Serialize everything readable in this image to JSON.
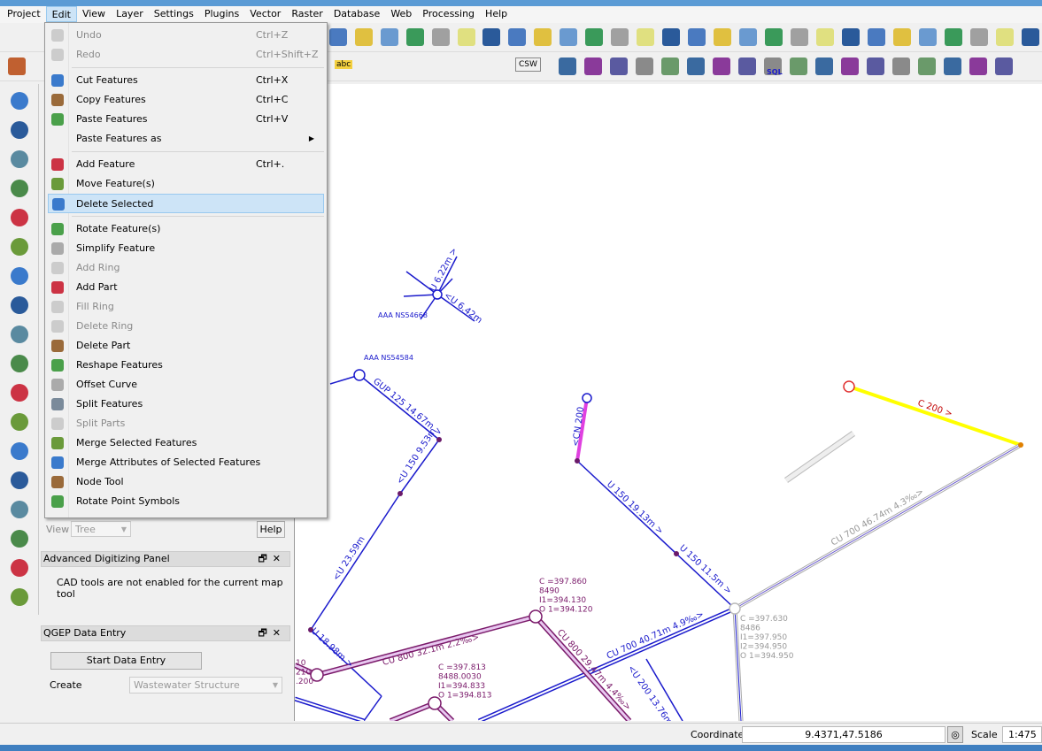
{
  "menubar": [
    "Project",
    "Edit",
    "View",
    "Layer",
    "Settings",
    "Plugins",
    "Vector",
    "Raster",
    "Database",
    "Web",
    "Processing",
    "Help"
  ],
  "edit_menu": [
    {
      "label": "Undo",
      "shortcut": "Ctrl+Z",
      "disabled": true,
      "icon": "undo-icon"
    },
    {
      "label": "Redo",
      "shortcut": "Ctrl+Shift+Z",
      "disabled": true,
      "icon": "redo-icon"
    },
    {
      "sep": true
    },
    {
      "label": "Cut Features",
      "shortcut": "Ctrl+X",
      "icon": "scissors-icon"
    },
    {
      "label": "Copy Features",
      "shortcut": "Ctrl+C",
      "icon": "copy-icon"
    },
    {
      "label": "Paste Features",
      "shortcut": "Ctrl+V",
      "icon": "paste-icon"
    },
    {
      "label": "Paste Features as",
      "submenu": true
    },
    {
      "sep": true
    },
    {
      "label": "Add Feature",
      "shortcut": "Ctrl+.",
      "icon": "add-feature-icon"
    },
    {
      "label": "Move Feature(s)",
      "icon": "move-feature-icon"
    },
    {
      "label": "Delete Selected",
      "icon": "trash-icon",
      "highlighted": true
    },
    {
      "sep": true
    },
    {
      "label": "Rotate Feature(s)",
      "icon": "rotate-feature-icon"
    },
    {
      "label": "Simplify Feature",
      "icon": "simplify-icon"
    },
    {
      "label": "Add Ring",
      "disabled": true,
      "icon": "add-ring-icon"
    },
    {
      "label": "Add Part",
      "icon": "add-part-icon"
    },
    {
      "label": "Fill Ring",
      "disabled": true,
      "icon": "fill-ring-icon"
    },
    {
      "label": "Delete Ring",
      "disabled": true,
      "icon": "delete-ring-icon"
    },
    {
      "label": "Delete Part",
      "icon": "delete-part-icon"
    },
    {
      "label": "Reshape Features",
      "icon": "reshape-icon"
    },
    {
      "label": "Offset Curve",
      "icon": "offset-curve-icon"
    },
    {
      "label": "Split Features",
      "icon": "split-features-icon"
    },
    {
      "label": "Split Parts",
      "disabled": true,
      "icon": "split-parts-icon"
    },
    {
      "label": "Merge Selected Features",
      "icon": "merge-features-icon"
    },
    {
      "label": "Merge Attributes of Selected Features",
      "icon": "merge-attributes-icon"
    },
    {
      "label": "Node Tool",
      "icon": "node-tool-icon"
    },
    {
      "label": "Rotate Point Symbols",
      "icon": "rotate-symbols-icon"
    }
  ],
  "toolbar": {
    "csw_label": "CSW",
    "sql_label": "SQL",
    "abc_label": "abc"
  },
  "layers_panel": {
    "view_label": "View",
    "view_value": "Tree",
    "help_label": "Help"
  },
  "advanced_digitizing": {
    "title": "Advanced Digitizing Panel",
    "message": "CAD tools are not enabled for the current map tool"
  },
  "qgep": {
    "title": "QGEP Data Entry",
    "start_button": "Start Data Entry",
    "create_label": "Create",
    "create_value": "Wastewater Structure"
  },
  "map_labels": {
    "l1": "AAA NS54668",
    "l2": "U 6.22m >",
    "l3": "<U 6.42m",
    "l4": "AAA NS54584",
    "l5": "GUP 125 14.67m >",
    "l6": "<U 150 9.53m",
    "l7": "<U 23.59m",
    "l8": "<CN 200",
    "l9": "U 150 19.13m >",
    "l10": "U 150 11.5m >",
    "l11": "C 200 >",
    "l12": "CU 700 46.74m 4.3‰>",
    "l13": "U 18.98m >",
    "l14": "CU 800 32.1m 2.2‰>",
    "l15": "CU 800 29.47m 4.4‰>",
    "l16": "CU 700 40.71m 4.9‰>",
    "l17": "<U 200 13.76m"
  },
  "node_labels": {
    "n1": [
      "C =397.860",
      "8490",
      "I1=394.130",
      "O 1=394.120"
    ],
    "n2": [
      "C =397.813",
      "8488.0030",
      "I1=394.833",
      "O 1=394.813"
    ],
    "n3": [
      "C =397.630",
      "8486",
      "I1=397.950",
      "I2=394.950",
      "O 1=394.950"
    ],
    "n4": [
      "10",
      "210",
      ".200"
    ]
  },
  "status": {
    "coordinate_label": "Coordinate",
    "coordinate_value": "9.4371,47.5186",
    "scale_label": "Scale",
    "scale_value": "1:475"
  },
  "colors": {
    "pipe_blue": "#1a1acc",
    "pipe_purple": "#7a1a6a",
    "highlight": "#ffff00",
    "magenta": "#e040e0",
    "node_red": "#e03030",
    "disabled": "#8a8a8a"
  }
}
